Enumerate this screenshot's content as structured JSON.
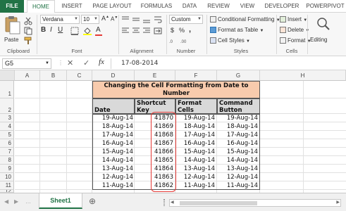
{
  "ribbon": {
    "tabs": [
      "FILE",
      "HOME",
      "INSERT",
      "PAGE LAYOUT",
      "FORMULAS",
      "DATA",
      "REVIEW",
      "VIEW",
      "DEVELOPER",
      "POWERPIVOT"
    ],
    "clipboard": {
      "paste": "Paste",
      "label": "Clipboard"
    },
    "font": {
      "name": "Verdana",
      "size": "10",
      "bold": "B",
      "italic": "I",
      "underline": "U",
      "label": "Font"
    },
    "alignment": {
      "label": "Alignment"
    },
    "number": {
      "format": "Custom",
      "currency": "$",
      "percent": "%",
      "comma": ",",
      "label": "Number"
    },
    "styles": {
      "conditional": "Conditional Formatting",
      "format_table": "Format as Table",
      "cell_styles": "Cell Styles",
      "label": "Styles"
    },
    "cells": {
      "insert": "Insert",
      "delete": "Delete",
      "format": "Format",
      "label": "Cells"
    },
    "editing": {
      "label": "Editing"
    }
  },
  "formula_bar": {
    "name_box": "G5",
    "cancel": "✕",
    "enter": "✓",
    "fx": "fx",
    "value": "17-08-2014"
  },
  "grid": {
    "columns": [
      "A",
      "B",
      "C",
      "D",
      "E",
      "F",
      "G",
      "H"
    ],
    "rows": [
      "1",
      "2",
      "3",
      "4",
      "5",
      "6",
      "7",
      "8",
      "9",
      "10",
      "11",
      "12"
    ],
    "title": "Changing the Cell Formatting from Date to Number",
    "headers": [
      "Date",
      "Shortcut Key",
      "Format Cells",
      "Command Button"
    ],
    "data": [
      [
        "19-Aug-14",
        "41870",
        "19-Aug-14",
        "19-Aug-14"
      ],
      [
        "18-Aug-14",
        "41869",
        "18-Aug-14",
        "18-Aug-14"
      ],
      [
        "17-Aug-14",
        "41868",
        "17-Aug-14",
        "17-Aug-14"
      ],
      [
        "16-Aug-14",
        "41867",
        "16-Aug-14",
        "16-Aug-14"
      ],
      [
        "15-Aug-14",
        "41866",
        "15-Aug-14",
        "15-Aug-14"
      ],
      [
        "14-Aug-14",
        "41865",
        "14-Aug-14",
        "14-Aug-14"
      ],
      [
        "13-Aug-14",
        "41864",
        "13-Aug-14",
        "13-Aug-14"
      ],
      [
        "12-Aug-14",
        "41863",
        "12-Aug-14",
        "12-Aug-14"
      ],
      [
        "11-Aug-14",
        "41862",
        "11-Aug-14",
        "11-Aug-14"
      ]
    ]
  },
  "sheets": {
    "active": "Sheet1",
    "add": "⊕"
  },
  "colors": {
    "excel_green": "#217346",
    "title_fill": "#f8cbad",
    "header_fill": "#d9d9d9",
    "highlight": "#e53935"
  }
}
